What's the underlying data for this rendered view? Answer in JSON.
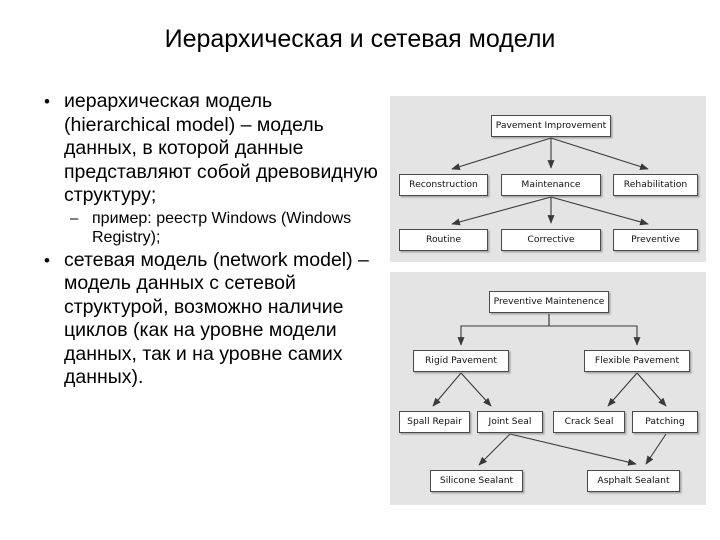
{
  "slide": {
    "title": "Иерархическая и сетевая модели"
  },
  "body": {
    "bullets": [
      {
        "level": 1,
        "marker": "•",
        "text": "иерархическая модель (hierarchical model) – модель данных, в которой данные представляют собой древовидную структуру;"
      },
      {
        "level": 2,
        "marker": "–",
        "text": "пример: реестр Windows (Windows Registry);"
      },
      {
        "level": 1,
        "marker": "•",
        "text": "сетевая модель (network model) – модель данных с сетевой структурой, возможно наличие циклов (как на уровне модели данных, так и на уровне самих данных)."
      }
    ]
  },
  "diagrams": {
    "hierarchical": {
      "name": "Pavement Improvement hierarchy",
      "nodes": {
        "root": "Pavement Improvement",
        "reconstruction": "Reconstruction",
        "maintenance": "Maintenance",
        "rehabilitation": "Rehabilitation",
        "routine": "Routine",
        "corrective": "Corrective",
        "preventive": "Preventive"
      },
      "edges": [
        "Pavement Improvement → Reconstruction",
        "Pavement Improvement → Maintenance",
        "Pavement Improvement → Rehabilitation",
        "Maintenance → Routine",
        "Maintenance → Corrective",
        "Maintenance → Preventive"
      ]
    },
    "network": {
      "name": "Preventive Maintenence network",
      "nodes": {
        "root": "Preventive Maintenence",
        "rigid": "Rigid Pavement",
        "flexible": "Flexible Pavement",
        "spall": "Spall Repair",
        "joint": "Joint Seal",
        "crack": "Crack Seal",
        "patching": "Patching",
        "silicone": "Silicone Sealant",
        "asphalt": "Asphalt Sealant"
      },
      "edges": [
        "Preventive Maintenence → Rigid Pavement",
        "Preventive Maintenence → Flexible Pavement",
        "Rigid Pavement → Spall Repair",
        "Rigid Pavement → Joint Seal",
        "Flexible Pavement → Crack Seal",
        "Flexible Pavement → Patching",
        "Joint Seal → Silicone Sealant",
        "Joint Seal → Asphalt Sealant",
        "Patching → Asphalt Sealant"
      ]
    }
  },
  "colors": {
    "panel_background": "#e4e4e4",
    "node_fill": "#ffffff",
    "node_border": "#4a4a4a",
    "connector": "#3a3a3a",
    "text": "#000000",
    "slide_background": "#ffffff"
  }
}
